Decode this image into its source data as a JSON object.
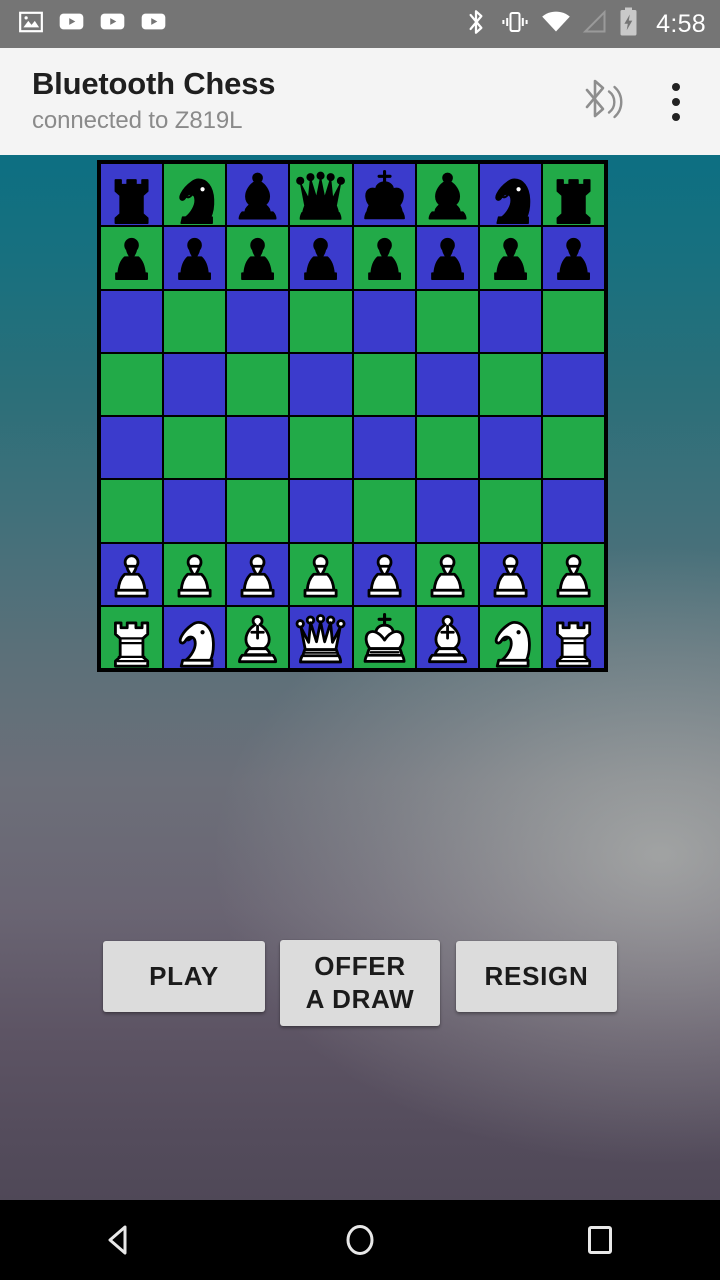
{
  "status_bar": {
    "background": "#757575",
    "time": "4:58",
    "left_icons": [
      {
        "name": "image-icon",
        "label": "image"
      },
      {
        "name": "youtube-icon-1",
        "label": "video"
      },
      {
        "name": "youtube-icon-2",
        "label": "video"
      },
      {
        "name": "youtube-icon-3",
        "label": "video"
      }
    ],
    "right_icons": [
      {
        "name": "bluetooth-icon",
        "label": "bluetooth"
      },
      {
        "name": "vibrate-icon",
        "label": "vibrate"
      },
      {
        "name": "wifi-icon",
        "label": "wifi full"
      },
      {
        "name": "cell-signal-icon",
        "label": "no signal"
      },
      {
        "name": "battery-charging-icon",
        "label": "battery charging"
      }
    ]
  },
  "app_bar": {
    "background": "#f4f4f4",
    "title": "Bluetooth Chess",
    "subtitle": "connected to Z819L",
    "bluetooth_connected_icon": "bluetooth-connected-icon",
    "overflow_menu": "overflow-menu-button"
  },
  "board": {
    "light_square_color": "#3b3bcc",
    "dark_square_color": "#22aa48",
    "border_color": "#000000",
    "white_piece_color": "#ffffff",
    "black_piece_color": "#000000",
    "orientation": "white-at-bottom",
    "rows": [
      [
        "r",
        "n",
        "b",
        "q",
        "k",
        "b",
        "n",
        "r"
      ],
      [
        "p",
        "p",
        "p",
        "p",
        "p",
        "p",
        "p",
        "p"
      ],
      [
        "",
        "",
        "",
        "",
        "",
        "",
        "",
        ""
      ],
      [
        "",
        "",
        "",
        "",
        "",
        "",
        "",
        ""
      ],
      [
        "",
        "",
        "",
        "",
        "",
        "",
        "",
        ""
      ],
      [
        "",
        "",
        "",
        "",
        "",
        "",
        "",
        ""
      ],
      [
        "P",
        "P",
        "P",
        "P",
        "P",
        "P",
        "P",
        "P"
      ],
      [
        "R",
        "N",
        "B",
        "Q",
        "K",
        "B",
        "N",
        "R"
      ]
    ],
    "piece_names": {
      "r": "black-rook",
      "n": "black-knight",
      "b": "black-bishop",
      "q": "black-queen",
      "k": "black-king",
      "p": "black-pawn",
      "R": "white-rook",
      "N": "white-knight",
      "B": "white-bishop",
      "Q": "white-queen",
      "K": "white-king",
      "P": "white-pawn"
    }
  },
  "actions": {
    "play_label": "PLAY",
    "offer_draw_label": "OFFER\nA DRAW",
    "offer_draw_line1": "OFFER",
    "offer_draw_line2": "A DRAW",
    "resign_label": "RESIGN",
    "button_background": "#dcdcdc"
  },
  "nav_bar": {
    "background": "#000000",
    "buttons": [
      {
        "name": "back-button",
        "icon": "triangle-left-icon"
      },
      {
        "name": "home-button",
        "icon": "circle-icon"
      },
      {
        "name": "recents-button",
        "icon": "square-icon"
      }
    ]
  }
}
